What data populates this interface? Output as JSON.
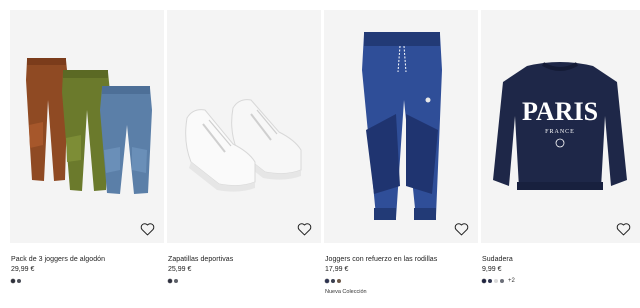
{
  "products": [
    {
      "title": "Pack de 3 joggers de algodón",
      "price": "29,99 €",
      "image": "three-joggers-pack",
      "swatches": [
        "#2d2f3a",
        "#4a4d57"
      ],
      "more": "",
      "badge": ""
    },
    {
      "title": "Zapatillas deportivas",
      "price": "25,99 €",
      "image": "white-sneakers",
      "swatches": [
        "#2f3140",
        "#5d6068"
      ],
      "more": "",
      "badge": ""
    },
    {
      "title": "Joggers con refuerzo en las rodillas",
      "price": "17,99 €",
      "image": "navy-joggers",
      "swatches": [
        "#2c3350",
        "#3a3f4f",
        "#6b5747"
      ],
      "more": "",
      "badge": "Nueva Colección"
    },
    {
      "title": "Sudadera",
      "price": "9,99 €",
      "image": "paris-sweatshirt",
      "swatches": [
        "#1f2440",
        "#2f3550",
        "#d9d9d9",
        "#6b6e78"
      ],
      "more": "+2",
      "badge": ""
    }
  ],
  "favorite_icon": "heart-outline-icon",
  "print_text": {
    "main": "PARIS",
    "sub": "FRANCE"
  }
}
